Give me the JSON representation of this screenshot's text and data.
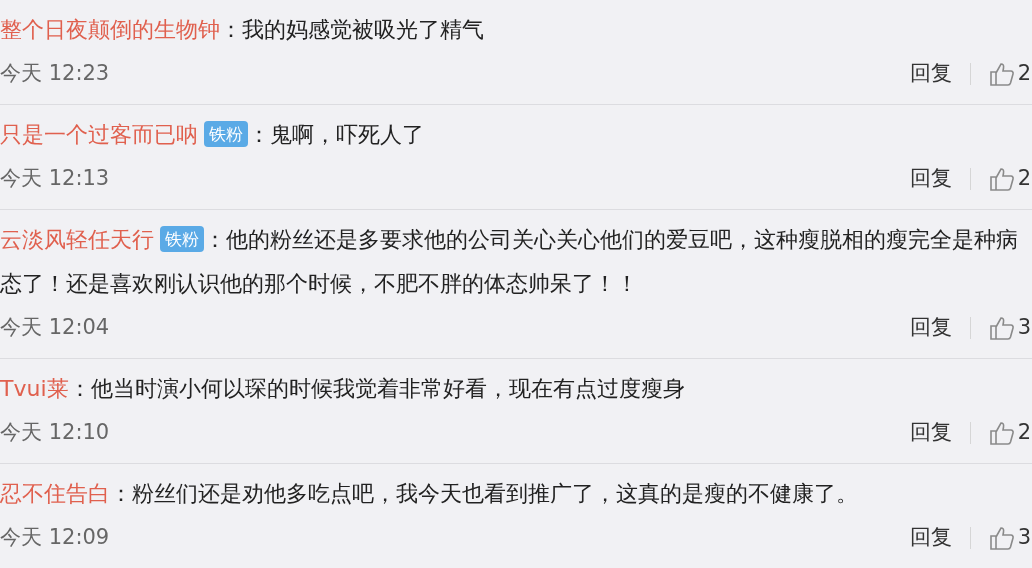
{
  "comments": [
    {
      "user": "整个日夜颠倒的生物钟",
      "text": "：我的妈感觉被吸光了精气",
      "time": "今天 12:23",
      "reply": "回复",
      "likes": "2"
    },
    {
      "user": "只是一个过客而已呐",
      "badge": "铁粉",
      "text": "：鬼啊，吓死人了",
      "time": "今天 12:13",
      "reply": "回复",
      "likes": "2"
    },
    {
      "user": "云淡风轻任天行",
      "badge": "铁粉",
      "text": "：他的粉丝还是多要求他的公司关心关心他们的爱豆吧，这种瘦脱相的瘦完全是种病态了！还是喜欢刚认识他的那个时候，不肥不胖的体态帅呆了！！",
      "time": "今天 12:04",
      "reply": "回复",
      "likes": "3"
    },
    {
      "user": "Tvui莱",
      "text": "：他当时演小何以琛的时候我觉着非常好看，现在有点过度瘦身",
      "time": "今天 12:10",
      "reply": "回复",
      "likes": "2"
    },
    {
      "user": "忍不住告白",
      "text": "：粉丝们还是劝他多吃点吧，我今天也看到推广了，这真的是瘦的不健康了。",
      "time": "今天 12:09",
      "reply": "回复",
      "likes": "3"
    }
  ]
}
